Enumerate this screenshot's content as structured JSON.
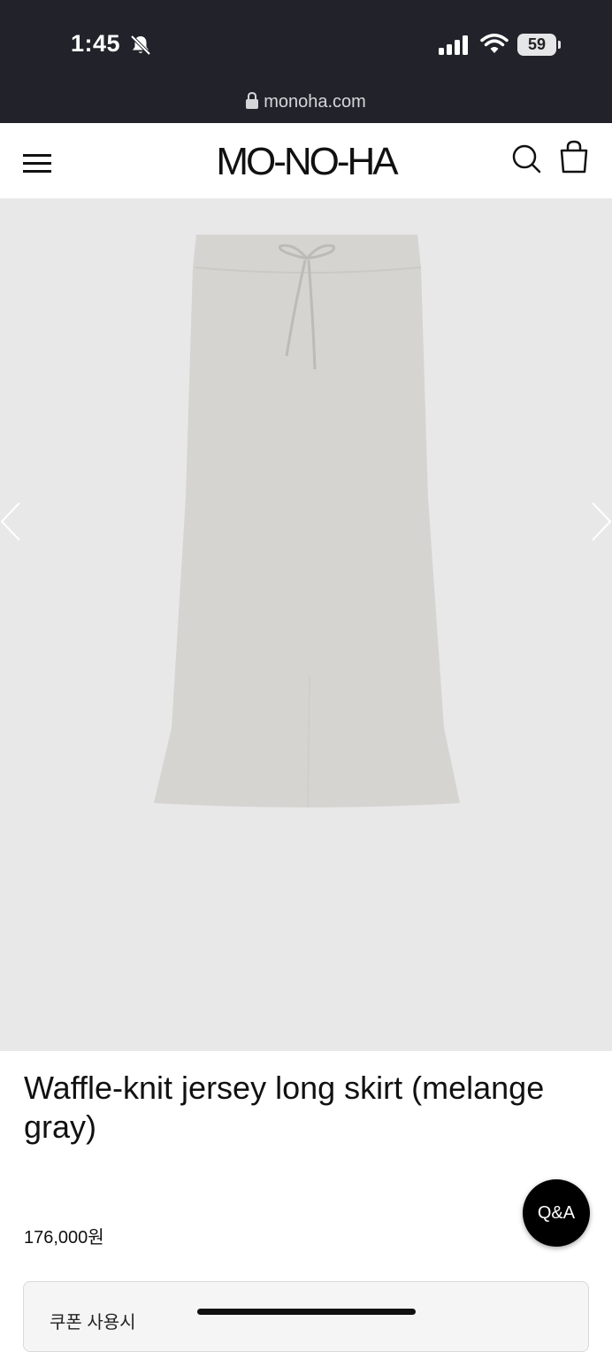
{
  "status_bar": {
    "time": "1:45",
    "battery": "59"
  },
  "browser": {
    "url": "monoha.com"
  },
  "header": {
    "logo": "MO-NO-HA"
  },
  "product": {
    "title": "Waffle-knit jersey long skirt (melange gray)",
    "price": "176,000원",
    "image_color": "#d6d4d1"
  },
  "qa_button": {
    "label": "Q&A"
  },
  "coupon": {
    "label": "쿠폰 사용시"
  }
}
